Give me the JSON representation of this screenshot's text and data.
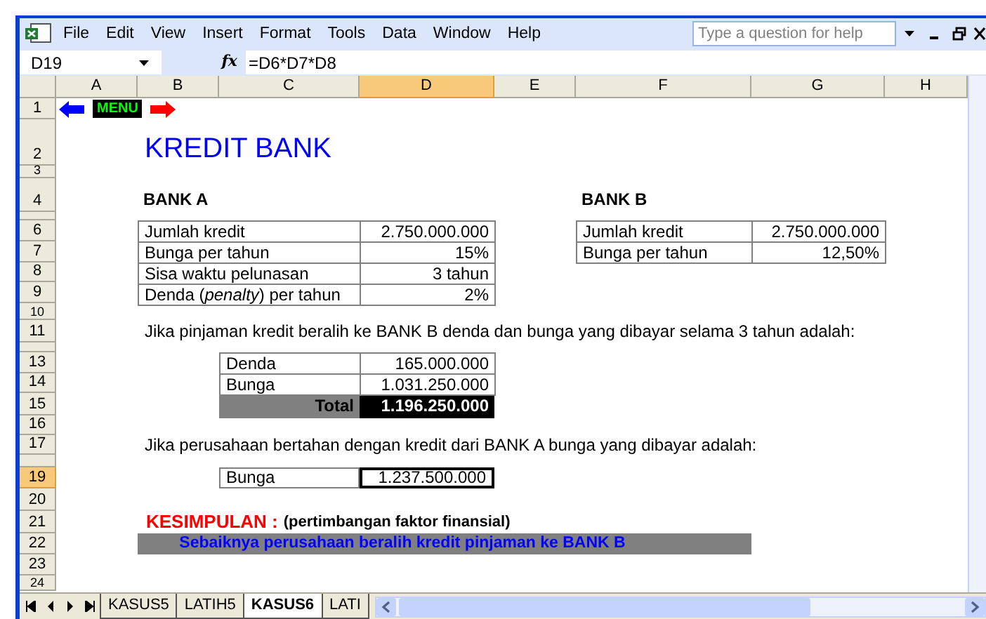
{
  "menu_bar": {
    "items": [
      "File",
      "Edit",
      "View",
      "Insert",
      "Format",
      "Tools",
      "Data",
      "Window",
      "Help"
    ],
    "help_search": {
      "placeholder": "Type a question for help"
    }
  },
  "formula_bar": {
    "name_box": "D19",
    "fx": "fx",
    "formula": "=D6*D7*D8"
  },
  "columns": [
    {
      "label": "A",
      "selected": false
    },
    {
      "label": "B",
      "selected": false
    },
    {
      "label": "C",
      "selected": false
    },
    {
      "label": "D",
      "selected": true
    },
    {
      "label": "E",
      "selected": false
    },
    {
      "label": "F",
      "selected": false
    },
    {
      "label": "G",
      "selected": false
    },
    {
      "label": "H",
      "selected": false
    }
  ],
  "rows": [
    {
      "label": "1",
      "selected": false
    },
    {
      "label": "2",
      "selected": false
    },
    {
      "label": "3",
      "selected": false
    },
    {
      "label": "4",
      "selected": false
    },
    {
      "selected": false
    },
    {
      "label": "6",
      "selected": false
    },
    {
      "label": "7",
      "selected": false
    },
    {
      "label": "8",
      "selected": false
    },
    {
      "label": "9",
      "selected": false
    },
    {
      "label": "10",
      "selected": false
    },
    {
      "label": "11",
      "selected": false
    },
    {
      "selected": false
    },
    {
      "label": "13",
      "selected": false
    },
    {
      "label": "14",
      "selected": false
    },
    {
      "label": "15",
      "selected": false
    },
    {
      "label": "16",
      "selected": false
    },
    {
      "label": "17",
      "selected": false
    },
    {
      "selected": false
    },
    {
      "label": "19",
      "selected": true
    },
    {
      "label": "20",
      "selected": false
    },
    {
      "label": "21",
      "selected": false
    },
    {
      "label": "22",
      "selected": false
    },
    {
      "label": "23",
      "selected": false
    },
    {
      "label": "24",
      "selected": false
    }
  ],
  "nav": {
    "menu_button": "MENU"
  },
  "title": "KREDIT BANK",
  "bank_a": {
    "heading": "BANK A",
    "rows": [
      {
        "label": "Jumlah kredit",
        "value": "2.750.000.000"
      },
      {
        "label": "Bunga per tahun",
        "value": "15%"
      },
      {
        "label": "Sisa waktu pelunasan",
        "value": "3 tahun"
      },
      {
        "label": "Denda (*penalty*) per tahun",
        "value": "2%"
      }
    ]
  },
  "bank_b": {
    "heading": "BANK B",
    "rows": [
      {
        "label": "Jumlah kredit",
        "value": "2.750.000.000"
      },
      {
        "label": "Bunga per tahun",
        "value": "12,50%"
      }
    ]
  },
  "note_switch": "Jika pinjaman kredit beralih ke BANK B denda dan bunga yang dibayar selama 3 tahun adalah:",
  "switch_table": {
    "rows": [
      {
        "label": "Denda",
        "value": "165.000.000"
      },
      {
        "label": "Bunga",
        "value": "1.031.250.000"
      }
    ],
    "total": {
      "label": "Total",
      "value": "1.196.250.000"
    }
  },
  "note_stay": "Jika perusahaan bertahan dengan kredit dari BANK A bunga yang dibayar adalah:",
  "stay_table": {
    "label": "Bunga",
    "value": "1.237.500.000",
    "selected": true
  },
  "conclusion": {
    "label": "KESIMPULAN :",
    "note": "(pertimbangan faktor finansial)",
    "text": "Sebaiknya perusahaan beralih kredit pinjaman ke BANK B"
  },
  "sheet_tabs": [
    {
      "label": "KASUS5",
      "selected": false
    },
    {
      "label": "LATIH5",
      "selected": false
    },
    {
      "label": "KASUS6",
      "selected": true
    },
    {
      "label": "LATI",
      "selected": false
    }
  ]
}
